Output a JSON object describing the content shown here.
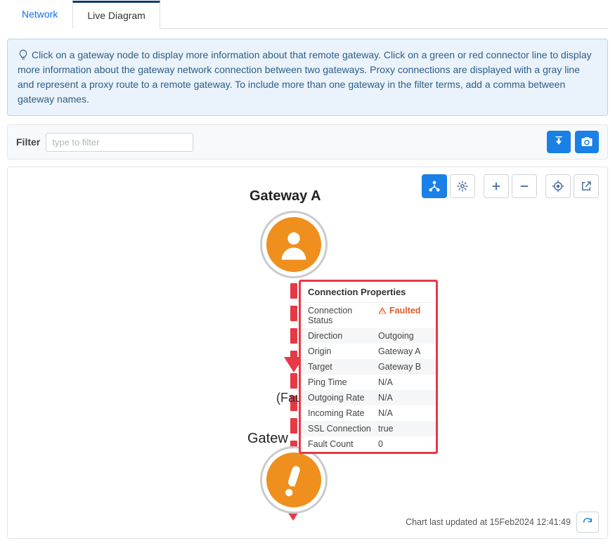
{
  "tabs": {
    "network": "Network",
    "live_diagram": "Live Diagram"
  },
  "info": "Click on a gateway node to display more information about that remote gateway. Click on a green or red connector line to display more information about the gateway network connection between two gateways. Proxy connections are displayed with a gray line and represent a proxy route to a remote gateway. To include more than one gateway in the filter terms, add a comma between gateway names.",
  "filter": {
    "label": "Filter",
    "placeholder": "type to filter"
  },
  "diagram": {
    "gateway_a": "Gateway A",
    "gateway_b_partial": "Gatew",
    "edge_label_partial": "(Fault",
    "footer_prefix": "Chart last updated at ",
    "footer_timestamp": "15Feb2024 12:41:49"
  },
  "popup": {
    "title": "Connection Properties",
    "rows": [
      {
        "k": "Connection Status",
        "v": "Faulted",
        "warn": true
      },
      {
        "k": "Direction",
        "v": "Outgoing"
      },
      {
        "k": "Origin",
        "v": "Gateway A"
      },
      {
        "k": "Target",
        "v": "Gateway B"
      },
      {
        "k": "Ping Time",
        "v": "N/A"
      },
      {
        "k": "Outgoing Rate",
        "v": "N/A"
      },
      {
        "k": "Incoming Rate",
        "v": "N/A"
      },
      {
        "k": "SSL Connection",
        "v": "true"
      },
      {
        "k": "Fault Count",
        "v": "0"
      }
    ]
  },
  "icons": {
    "download": "download-icon",
    "camera": "camera-icon",
    "tree": "tree-layout-icon",
    "target": "center-icon",
    "plus": "zoom-in-icon",
    "minus": "zoom-out-icon",
    "locate": "locate-icon",
    "popout": "popout-icon",
    "refresh": "refresh-icon"
  },
  "colors": {
    "accent": "#1a80e6",
    "fault": "#e63946",
    "node": "#ef8f1e"
  }
}
